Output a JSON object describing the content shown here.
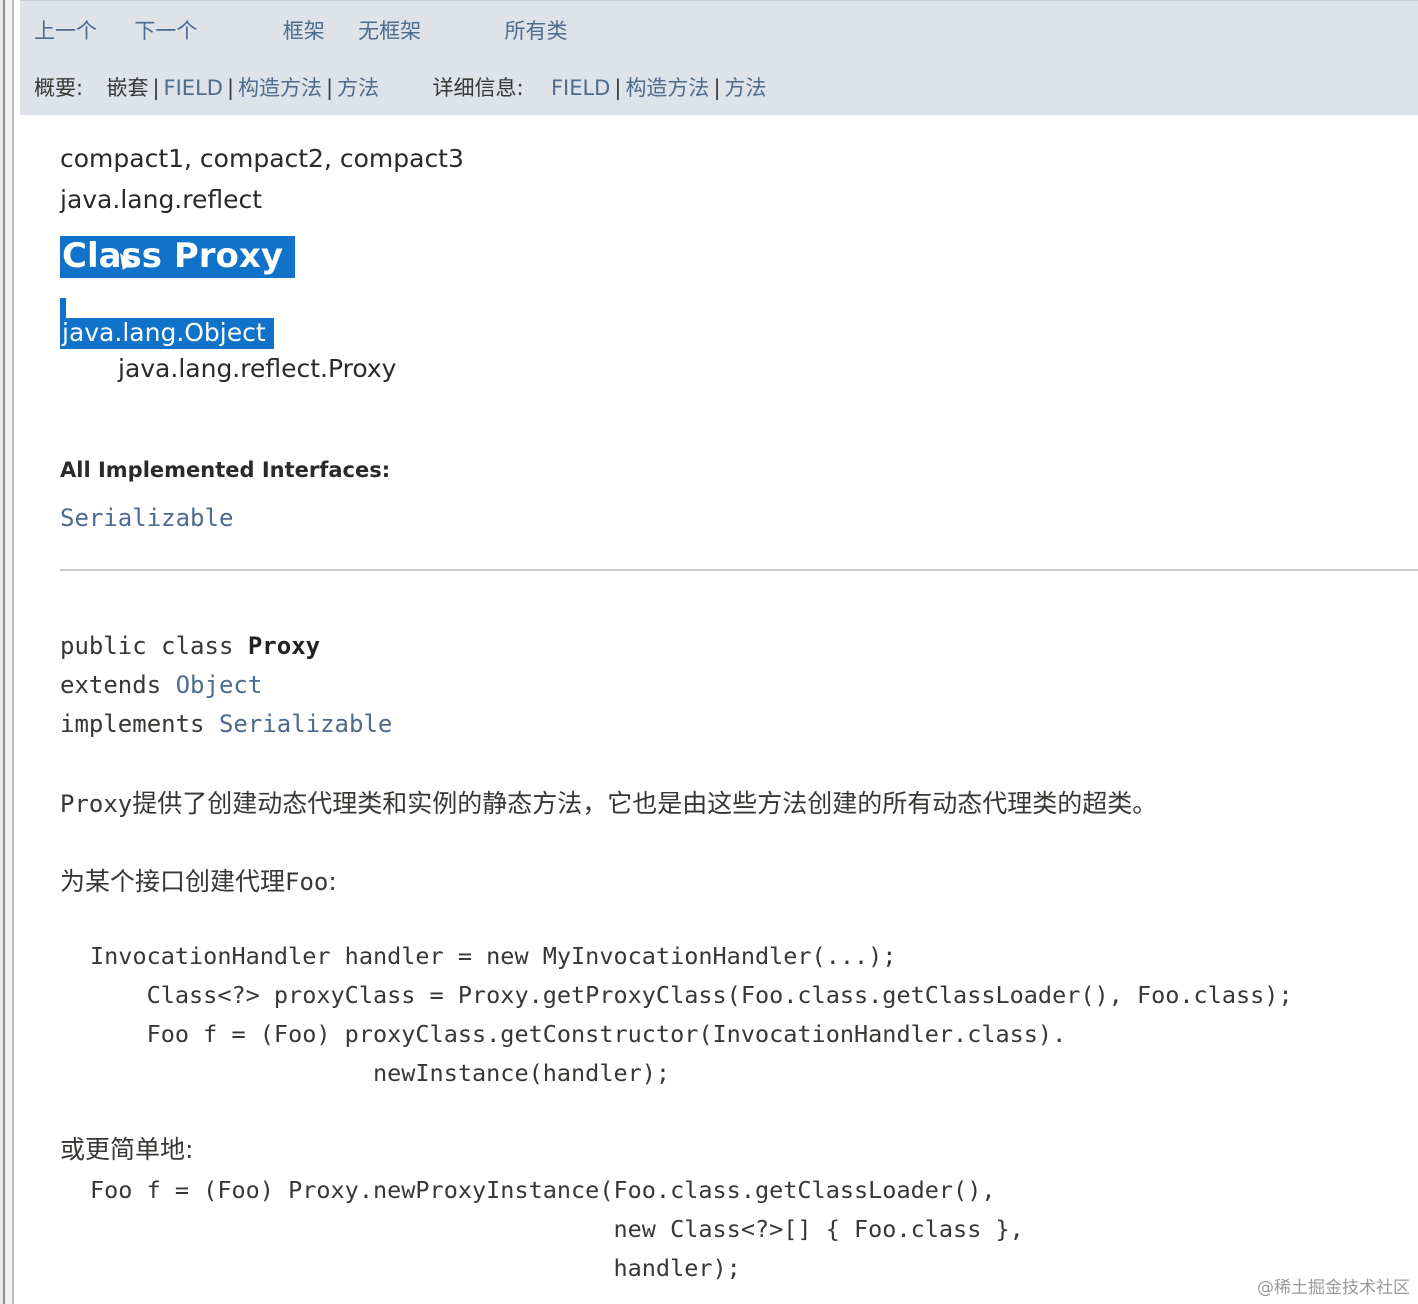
{
  "topnav": {
    "row1": {
      "prev": "上一个",
      "next": "下一个",
      "frames": "框架",
      "no_frames": "无框架",
      "all_classes": "所有类"
    },
    "row2": {
      "summary_label": "概要:",
      "nested": "嵌套",
      "sep": "|",
      "field": "FIELD",
      "constr": "构造方法",
      "method": "方法",
      "detail_label": "详细信息:",
      "detail_field": "FIELD",
      "detail_constr": "构造方法",
      "detail_method": "方法"
    }
  },
  "header": {
    "profiles": "compact1, compact2, compact3",
    "package": "java.lang.reflect",
    "class_title": "Class Proxy"
  },
  "inheritance": {
    "root": "java.lang.Object",
    "child": "java.lang.reflect.Proxy"
  },
  "interfaces": {
    "label": "All Implemented Interfaces:",
    "items": [
      "Serializable"
    ]
  },
  "signature": {
    "line1_pre": "public class ",
    "line1_name": "Proxy",
    "line2_kw": "extends ",
    "line2_link": "Object",
    "line3_kw": "implements ",
    "line3_link": "Serializable"
  },
  "description": {
    "para1_code": "Proxy",
    "para1_text": "提供了创建动态代理类和实例的静态方法，它也是由这些方法创建的所有动态代理类的超类。",
    "para2_text": "为某个接口创建代理",
    "para2_code": "Foo",
    "para2_tail": ":",
    "code1": [
      "InvocationHandler handler = new MyInvocationHandler(...);",
      "    Class<?> proxyClass = Proxy.getProxyClass(Foo.class.getClassLoader(), Foo.class);",
      "    Foo f = (Foo) proxyClass.getConstructor(InvocationHandler.class).",
      "                    newInstance(handler);"
    ],
    "para3_text": "或更简单地:",
    "code2": [
      "Foo f = (Foo) Proxy.newProxyInstance(Foo.class.getClassLoader(),",
      "                                     new Class<?>[] { Foo.class },",
      "                                     handler);"
    ]
  },
  "watermark": "@稀土掘金技术社区",
  "colors": {
    "nav_bg": "#dee3e9",
    "link": "#4d6b8c",
    "selection": "#1072c8",
    "text": "#353833"
  }
}
